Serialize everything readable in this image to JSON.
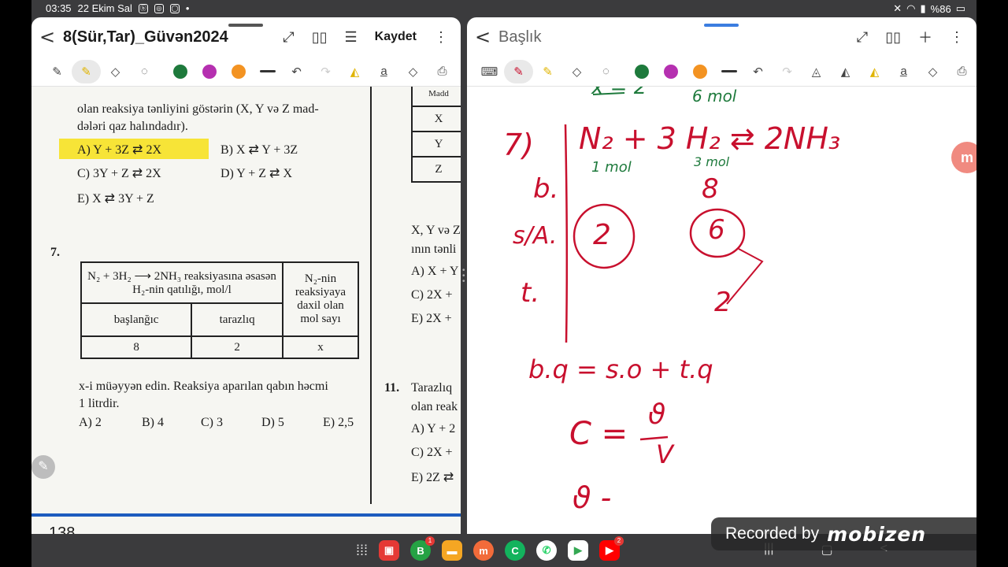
{
  "status_bar": {
    "time": "03:35",
    "date": "22 Ekim Sal",
    "battery": "%86"
  },
  "left_panel": {
    "title": "8(Sür,Tar)_Güvən2024",
    "save_label": "Kaydet",
    "page": {
      "question6_text_1": "olan reaksiya tənliyini göstərin (X, Y və Z mad-",
      "question6_text_2": "dələri qaz halındadır).",
      "q6_options": {
        "a": "A) Y + 3Z ⇄ 2X",
        "b": "B) X ⇄ Y + 3Z",
        "c": "C) 3Y + Z ⇄ 2X",
        "d": "D) Y + Z ⇄ X",
        "e": "E) X ⇄ 3Y + Z"
      },
      "q7_number": "7.",
      "q7_table": {
        "header_main": "N₂ + 3H₂ ⟶ 2NH₃ reaksiyasına əsasən H₂-nin qatılığı, mol/l",
        "header_side": "N₂-nin reaksiyaya daxil olan mol sayı",
        "col1": "başlanğıc",
        "col2": "tarazlıq",
        "val1": "8",
        "val2": "2",
        "val3": "x"
      },
      "q7_text_1": "x-i müəyyən edin. Reaksiya aparılan qabın həcmi",
      "q7_text_2": "1 litrdir.",
      "q7_options": {
        "a": "A) 2",
        "b": "B) 4",
        "c": "C) 3",
        "d": "D) 5",
        "e": "E) 2,5"
      },
      "right_col": {
        "mad": "Madd",
        "row_x": "X",
        "row_y": "Y",
        "row_z": "Z",
        "text_1": "X, Y və Z",
        "text_2": "ının tənli",
        "opt_a": "A) X + Y",
        "opt_c": "C) 2X +",
        "opt_e": "E) 2X +",
        "q11_number": "11.",
        "q11_text_1": "Tarazlıq",
        "q11_text_2": "olan reak",
        "q11_opt_a": "A) Y + 2",
        "q11_opt_c": "C) 2X +",
        "q11_opt_e": "E) 2Z ⇄"
      },
      "page_number": "138"
    }
  },
  "right_panel": {
    "title": "Başlık",
    "handwriting": {
      "top_partial": "x = 2",
      "top_partial_2": "6 mol",
      "q_num": "7)",
      "equation": "N₂ + 3 H₂ ⇄ 2NH₃",
      "under_n2": "1 mol",
      "under_h2": "3 mol",
      "row_b": "b.",
      "row_b_val": "8",
      "row_sa": "s/A.",
      "circle_1": "2",
      "circle_2": "6",
      "row_t": "t.",
      "t_val": "2",
      "formula_1": "b.q = s.o + t.q",
      "formula_2_lhs": "C =",
      "formula_2_num": "ϑ",
      "formula_2_den": "V",
      "formula_3": "ϑ -"
    }
  },
  "recorder": {
    "label": "Recorded by",
    "brand": "mobizen"
  },
  "colors": {
    "ink_red": "#c8102e",
    "ink_green": "#1e7a3c",
    "highlight": "#f7e437",
    "accent_blue": "#1d5cbf"
  }
}
